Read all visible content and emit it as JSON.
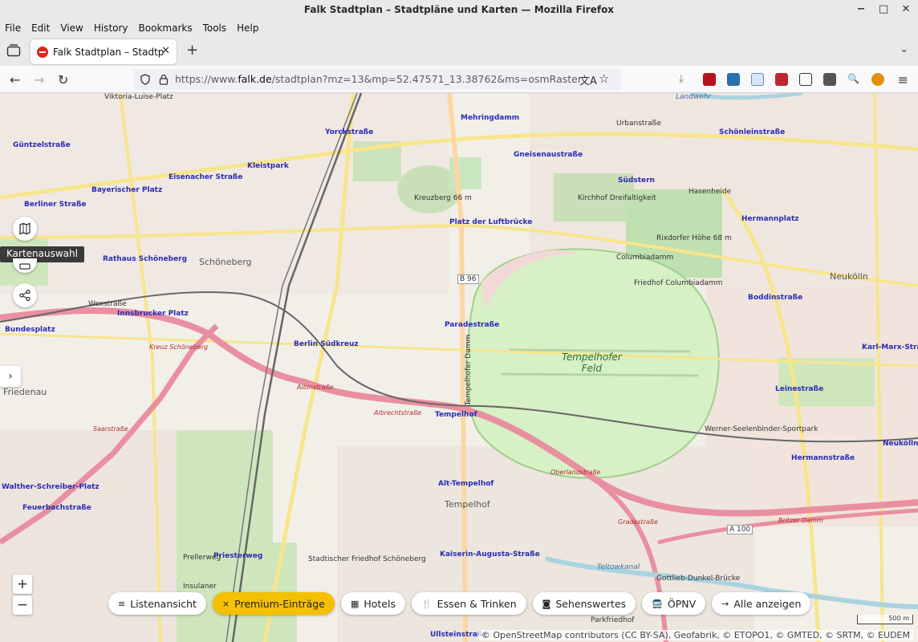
{
  "window": {
    "title": "Falk Stadtplan – Stadtpläne und Karten — Mozilla Firefox"
  },
  "menubar": [
    "File",
    "Edit",
    "View",
    "History",
    "Bookmarks",
    "Tools",
    "Help"
  ],
  "tab": {
    "title": "Falk Stadtplan – Stadtpläne"
  },
  "urlbar": {
    "prefix": "https://www.",
    "domain": "falk.de",
    "path": "/stadtplan?mz=13&mp=52.47571_13.38762&ms=osmRaster"
  },
  "map": {
    "tooltip": "Kartenauswahl",
    "field_name": "Tempelhofer\nFeld",
    "districts": [
      "Schöneberg",
      "Tempelhof",
      "Neukölln",
      "Friedenau"
    ],
    "labels": [
      "Yorckstraße",
      "Mehringdamm",
      "Urbanstraße",
      "Schönleinstraße",
      "Güntzelstraße",
      "Kleistpark",
      "Gneisenaustraße",
      "Eisenacher Straße",
      "Bayerischer Platz",
      "Südstern",
      "Hasenheide",
      "Kreuzberg 66 m",
      "Kirchhof Dreifaltigkeit",
      "Berliner Straße",
      "Platz der Luftbrücke",
      "Hermannplatz",
      "Rixdorfer Höhe 68 m",
      "Rathaus Schöneberg",
      "Columbiadamm",
      "Friedhof Columbiadamm",
      "B 96",
      "Wexstraße",
      "Innsbrucker Platz",
      "Boddinstraße",
      "Bundesplatz",
      "Paradestraße",
      "Kreuz Schöneberg",
      "Berlin Südkreuz",
      "Tempelhofer Damm",
      "Karl-Marx-Straße",
      "Leinestraße",
      "Albrechtstraße",
      "Albinstraße",
      "Tempelhof",
      "Werner-Seelenbinder-Sportpark",
      "Saarstraße",
      "Oberlandstraße",
      "Hermannstraße",
      "Walther-Schreiber-Platz",
      "Alt-Tempelhof",
      "Feuerbachstraße",
      "Gradestraße",
      "A 100",
      "Britzer Damm",
      "Priesterweg",
      "Prellerweg",
      "Kaiserin-Augusta-Straße",
      "Gottlieb-Dunkel-Brücke",
      "Teltowkanal",
      "Stadtischer Friedhof Schöneberg",
      "Insulaner",
      "Parkfriedhof",
      "Ullsteinstraße",
      "Neukölln",
      "Viktoria-Luise-Platz",
      "Landwehr"
    ]
  },
  "pills": [
    {
      "icon": "≡",
      "label": "Listenansicht",
      "active": false
    },
    {
      "icon": "×",
      "label": "Premium-Einträge",
      "active": true
    },
    {
      "icon": "▦",
      "label": "Hotels",
      "active": false
    },
    {
      "icon": "🍴",
      "label": "Essen & Trinken",
      "active": false
    },
    {
      "icon": "◙",
      "label": "Sehenswertes",
      "active": false
    },
    {
      "icon": "🚍",
      "label": "ÖPNV",
      "active": false
    },
    {
      "icon": "→",
      "label": "Alle anzeigen",
      "active": false
    }
  ],
  "zoom": {
    "in": "+",
    "out": "−"
  },
  "scale": "500 m",
  "attribution": "© OpenStreetMap contributors (CC BY-SA), Geofabrik, © ETOPO1, © GMTED, © SRTM, © EUDEM"
}
